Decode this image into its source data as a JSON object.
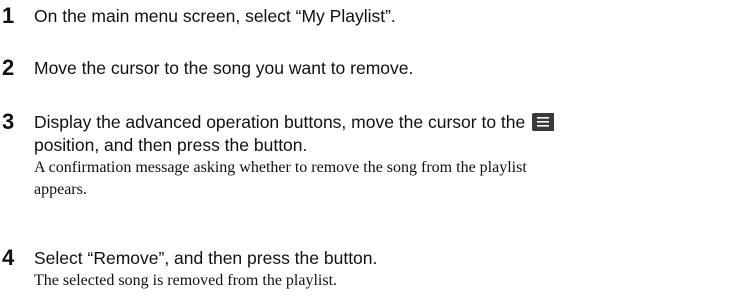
{
  "steps": [
    {
      "number": "1",
      "text": "On the main menu screen, select “My Playlist”."
    },
    {
      "number": "2",
      "text": "Move the cursor to the song you want to remove."
    },
    {
      "number": "3",
      "text_line1": "Display the advanced operation buttons, move the cursor to the",
      "icon": "menu-list-icon",
      "text_line2": "position, and then press the button.",
      "note_line1": "A confirmation message asking whether to remove the song from the playlist",
      "note_line2": "appears."
    },
    {
      "number": "4",
      "text": "Select “Remove”, and then press the button.",
      "note": "The selected song is removed from the playlist."
    }
  ]
}
